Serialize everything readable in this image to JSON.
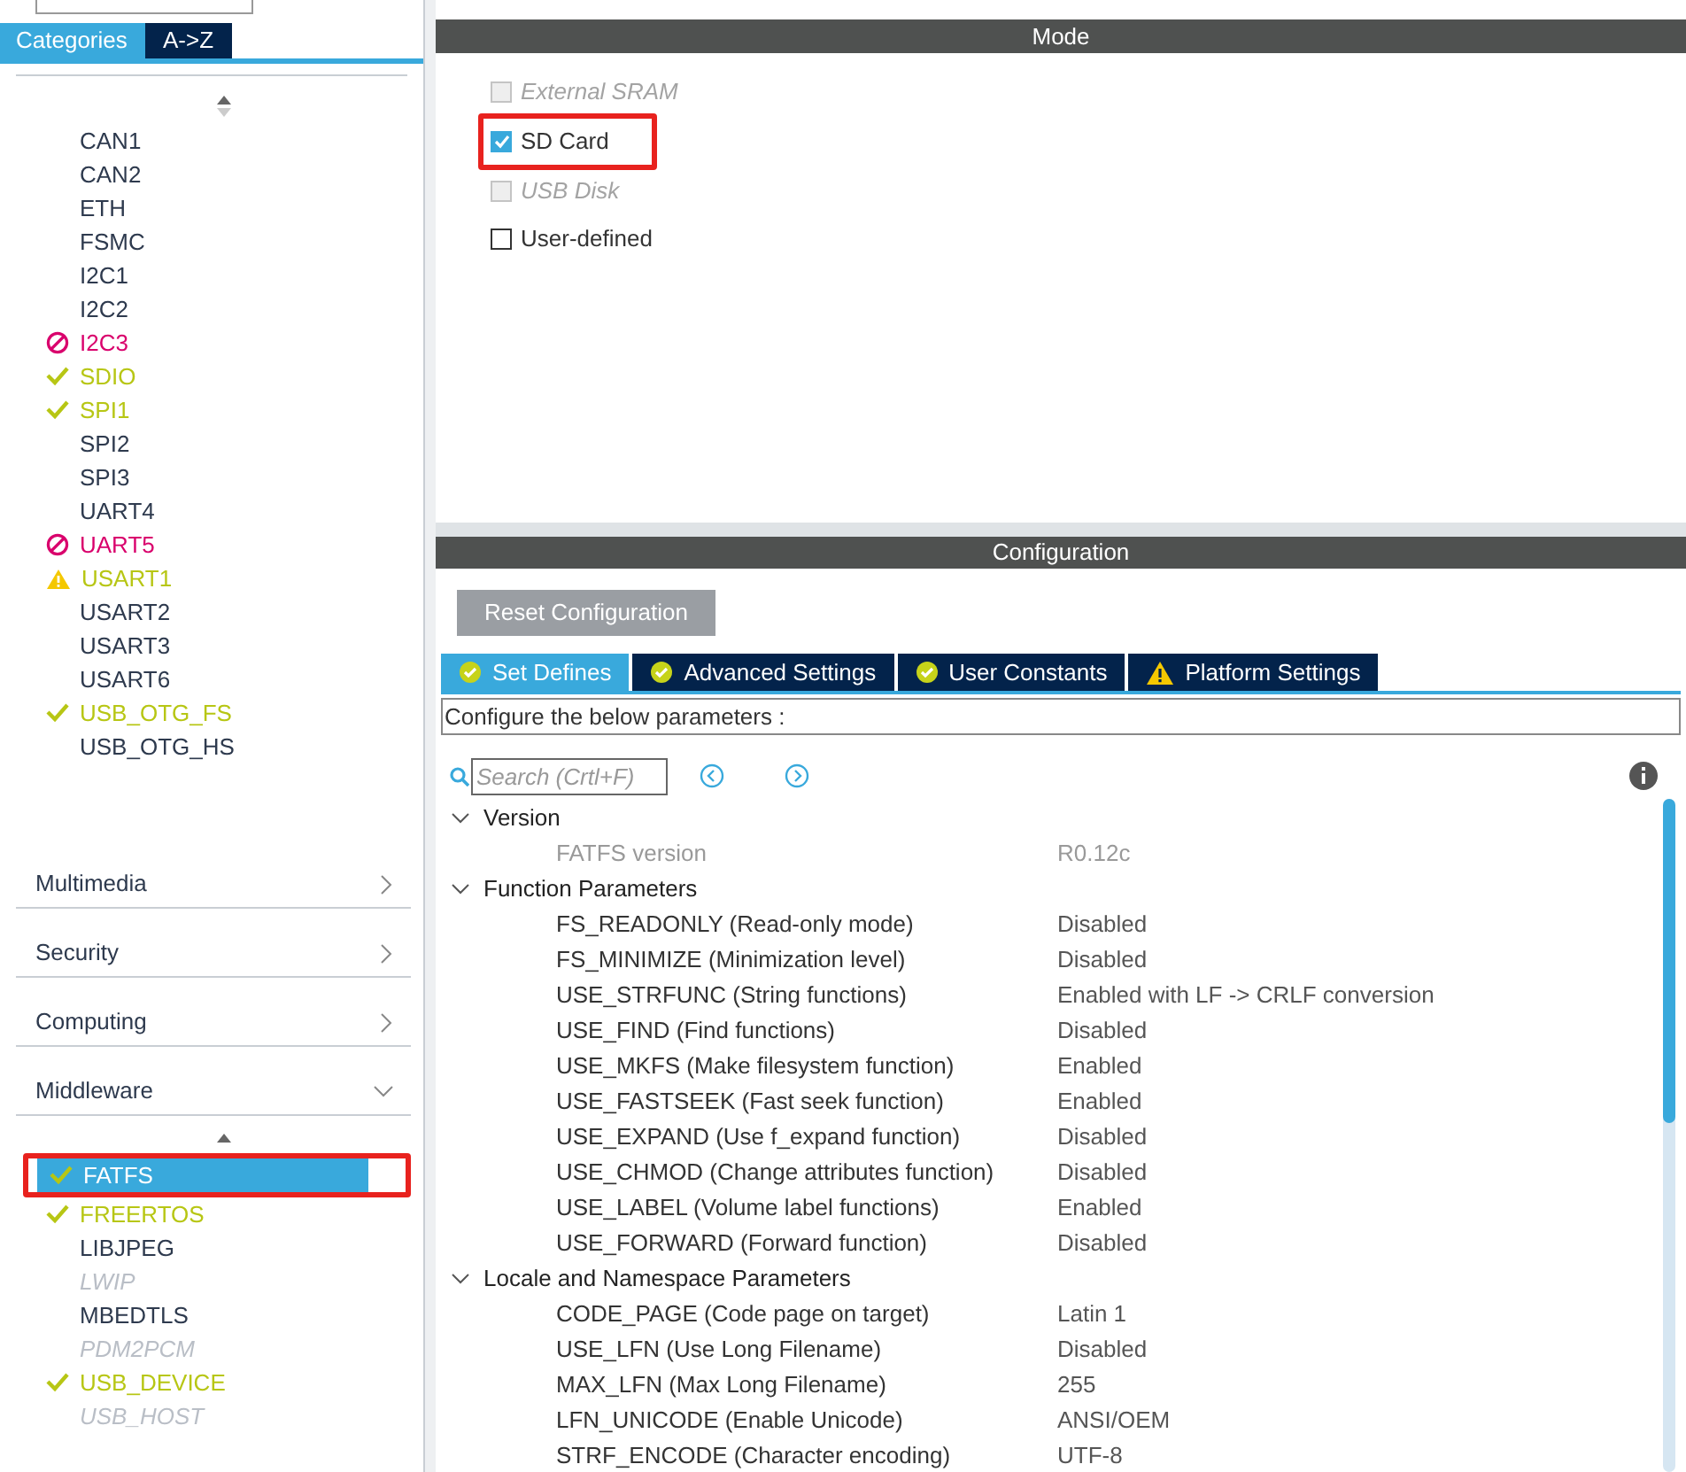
{
  "sidebar": {
    "tabs": [
      {
        "label": "Categories",
        "selected": true
      },
      {
        "label": "A->Z",
        "selected": false
      }
    ],
    "peripherals": [
      {
        "label": "CAN1",
        "kind": "none",
        "selected": false
      },
      {
        "label": "CAN2",
        "kind": "none",
        "selected": false
      },
      {
        "label": "ETH",
        "kind": "none",
        "selected": false
      },
      {
        "label": "FSMC",
        "kind": "none",
        "selected": false
      },
      {
        "label": "I2C1",
        "kind": "none",
        "selected": false
      },
      {
        "label": "I2C2",
        "kind": "none",
        "selected": false
      },
      {
        "label": "I2C3",
        "kind": "error",
        "selected": false
      },
      {
        "label": "SDIO",
        "kind": "ok",
        "selected": false
      },
      {
        "label": "SPI1",
        "kind": "ok",
        "selected": false
      },
      {
        "label": "SPI2",
        "kind": "none",
        "selected": false
      },
      {
        "label": "SPI3",
        "kind": "none",
        "selected": false
      },
      {
        "label": "UART4",
        "kind": "none",
        "selected": false
      },
      {
        "label": "UART5",
        "kind": "error",
        "selected": false
      },
      {
        "label": "USART1",
        "kind": "warning",
        "selected": false
      },
      {
        "label": "USART2",
        "kind": "none",
        "selected": false
      },
      {
        "label": "USART3",
        "kind": "none",
        "selected": false
      },
      {
        "label": "USART6",
        "kind": "none",
        "selected": false
      },
      {
        "label": "USB_OTG_FS",
        "kind": "ok",
        "selected": false
      },
      {
        "label": "USB_OTG_HS",
        "kind": "none",
        "selected": false
      }
    ],
    "categories": [
      {
        "label": "Multimedia",
        "expanded": false
      },
      {
        "label": "Security",
        "expanded": false
      },
      {
        "label": "Computing",
        "expanded": false
      },
      {
        "label": "Middleware",
        "expanded": true
      }
    ],
    "middleware": [
      {
        "label": "FATFS",
        "kind": "ok",
        "selected": true,
        "highlighted": true
      },
      {
        "label": "FREERTOS",
        "kind": "ok",
        "selected": false,
        "highlighted": false
      },
      {
        "label": "LIBJPEG",
        "kind": "none",
        "selected": false,
        "highlighted": false
      },
      {
        "label": "LWIP",
        "kind": "disabled",
        "selected": false,
        "highlighted": false
      },
      {
        "label": "MBEDTLS",
        "kind": "none",
        "selected": false,
        "highlighted": false
      },
      {
        "label": "PDM2PCM",
        "kind": "disabled",
        "selected": false,
        "highlighted": false
      },
      {
        "label": "USB_DEVICE",
        "kind": "ok",
        "selected": false,
        "highlighted": false
      },
      {
        "label": "USB_HOST",
        "kind": "disabled",
        "selected": false,
        "highlighted": false
      }
    ]
  },
  "mode": {
    "title": "Mode",
    "options": [
      {
        "label": "External SRAM",
        "checked": false,
        "disabled": true,
        "highlighted": false
      },
      {
        "label": "SD Card",
        "checked": true,
        "disabled": false,
        "highlighted": true
      },
      {
        "label": "USB Disk",
        "checked": false,
        "disabled": true,
        "highlighted": false
      },
      {
        "label": "User-defined",
        "checked": false,
        "disabled": false,
        "highlighted": false
      }
    ]
  },
  "configuration": {
    "title": "Configuration",
    "reset_button": "Reset Configuration",
    "tabs": [
      {
        "label": "Set Defines",
        "kind": "ok",
        "selected": true
      },
      {
        "label": "Advanced Settings",
        "kind": "ok",
        "selected": false
      },
      {
        "label": "User Constants",
        "kind": "ok",
        "selected": false
      },
      {
        "label": "Platform Settings",
        "kind": "warning",
        "selected": false
      }
    ],
    "description": "Configure the below parameters :",
    "search": {
      "placeholder": "Search (Crtl+F)"
    },
    "groups": [
      {
        "label": "Version",
        "expanded": true,
        "params": [
          {
            "name": "FATFS version",
            "value": "R0.12c",
            "disabled": true
          }
        ]
      },
      {
        "label": "Function Parameters",
        "expanded": true,
        "params": [
          {
            "name": "FS_READONLY (Read-only mode)",
            "value": "Disabled",
            "disabled": false
          },
          {
            "name": "FS_MINIMIZE (Minimization level)",
            "value": "Disabled",
            "disabled": false
          },
          {
            "name": "USE_STRFUNC (String functions)",
            "value": "Enabled with LF -> CRLF conversion",
            "disabled": false
          },
          {
            "name": "USE_FIND (Find functions)",
            "value": "Disabled",
            "disabled": false
          },
          {
            "name": "USE_MKFS (Make filesystem function)",
            "value": "Enabled",
            "disabled": false
          },
          {
            "name": "USE_FASTSEEK (Fast seek function)",
            "value": "Enabled",
            "disabled": false
          },
          {
            "name": "USE_EXPAND (Use f_expand function)",
            "value": "Disabled",
            "disabled": false
          },
          {
            "name": "USE_CHMOD (Change attributes function)",
            "value": "Disabled",
            "disabled": false
          },
          {
            "name": "USE_LABEL (Volume label functions)",
            "value": "Enabled",
            "disabled": false
          },
          {
            "name": "USE_FORWARD (Forward function)",
            "value": "Disabled",
            "disabled": false
          }
        ]
      },
      {
        "label": "Locale and Namespace Parameters",
        "expanded": true,
        "params": [
          {
            "name": "CODE_PAGE (Code page on target)",
            "value": "Latin 1",
            "disabled": false
          },
          {
            "name": "USE_LFN (Use Long Filename)",
            "value": "Disabled",
            "disabled": false
          },
          {
            "name": "MAX_LFN (Max Long Filename)",
            "value": "255",
            "disabled": false
          },
          {
            "name": "LFN_UNICODE (Enable Unicode)",
            "value": "ANSI/OEM",
            "disabled": false
          },
          {
            "name": "STRF_ENCODE (Character encoding)",
            "value": "UTF-8",
            "disabled": false
          }
        ]
      }
    ]
  }
}
